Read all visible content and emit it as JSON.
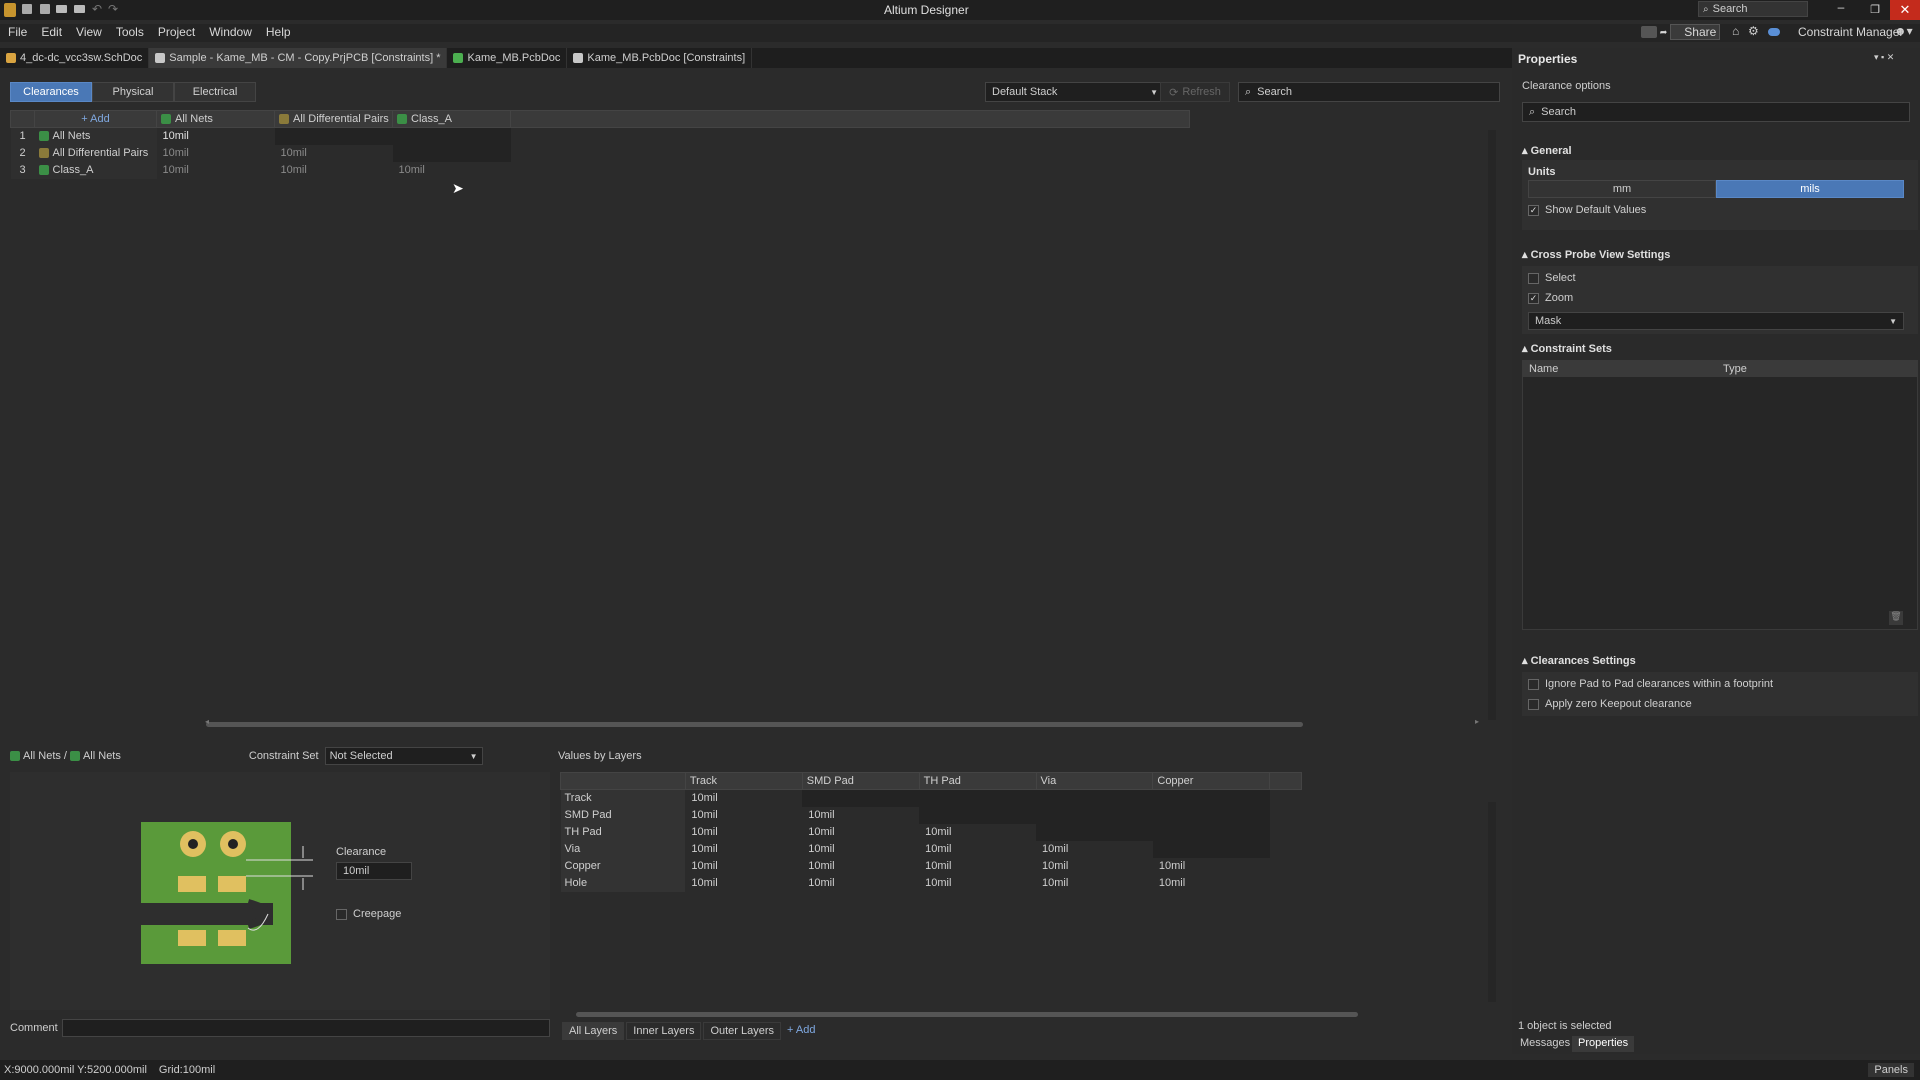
{
  "app": {
    "title": "Altium Designer",
    "search": "Search",
    "share": "Share",
    "constraint_manager": "Constraint Manager"
  },
  "menu": [
    "File",
    "Edit",
    "View",
    "Tools",
    "Project",
    "Window",
    "Help"
  ],
  "tabs": [
    {
      "label": "4_dc-dc_vcc3sw.SchDoc",
      "color": "#d9a441"
    },
    {
      "label": "Sample - Kame_MB - CM - Copy.PrjPCB [Constraints] *",
      "color": "#c8c8c8"
    },
    {
      "label": "Kame_MB.PcbDoc",
      "color": "#4caf50"
    },
    {
      "label": "Kame_MB.PcbDoc [Constraints]",
      "color": "#c8c8c8"
    }
  ],
  "toolbar": {
    "tabs": [
      "Clearances",
      "Physical",
      "Electrical"
    ],
    "stack": "Default Stack",
    "refresh": "Refresh",
    "search": "Search"
  },
  "matrix": {
    "add": "+ Add",
    "columns": [
      "All Nets",
      "All Differential Pairs",
      "Class_A"
    ],
    "rows": [
      {
        "num": "1",
        "name": "All Nets",
        "vals": [
          "10mil",
          "",
          ""
        ]
      },
      {
        "num": "2",
        "name": "All Differential Pairs",
        "vals": [
          "10mil",
          "10mil",
          ""
        ]
      },
      {
        "num": "3",
        "name": "Class_A",
        "vals": [
          "10mil",
          "10mil",
          "10mil"
        ]
      }
    ]
  },
  "detail": {
    "breadcrumb_a": "All Nets",
    "separator": "/",
    "breadcrumb_b": "All Nets",
    "constraint_set_label": "Constraint Set",
    "constraint_set_value": "Not Selected",
    "values_by_layers": "Values by Layers",
    "clearance_label": "Clearance",
    "clearance_value": "10mil",
    "creepage": "Creepage",
    "comment": "Comment"
  },
  "layers": {
    "columns": [
      "Track",
      "SMD Pad",
      "TH Pad",
      "Via",
      "Copper"
    ],
    "rows": [
      {
        "name": "Track",
        "vals": [
          "10mil",
          "",
          "",
          "",
          ""
        ]
      },
      {
        "name": "SMD Pad",
        "vals": [
          "10mil",
          "10mil",
          "",
          "",
          ""
        ]
      },
      {
        "name": "TH Pad",
        "vals": [
          "10mil",
          "10mil",
          "10mil",
          "",
          ""
        ]
      },
      {
        "name": "Via",
        "vals": [
          "10mil",
          "10mil",
          "10mil",
          "10mil",
          ""
        ]
      },
      {
        "name": "Copper",
        "vals": [
          "10mil",
          "10mil",
          "10mil",
          "10mil",
          "10mil"
        ]
      },
      {
        "name": "Hole",
        "vals": [
          "10mil",
          "10mil",
          "10mil",
          "10mil",
          "10mil"
        ]
      }
    ],
    "tabs": [
      "All Layers",
      "Inner Layers",
      "Outer Layers"
    ],
    "add": "+ Add"
  },
  "properties": {
    "title": "Properties",
    "subtitle": "Clearance options",
    "search": "Search",
    "general": "General",
    "units": "Units",
    "unit_mm": "mm",
    "unit_mils": "mils",
    "show_defaults": "Show Default Values",
    "cross_probe": "Cross Probe View Settings",
    "select": "Select",
    "zoom": "Zoom",
    "mode": "Mask",
    "constraint_sets": "Constraint Sets",
    "col_name": "Name",
    "col_type": "Type",
    "clearances_settings": "Clearances Settings",
    "ignore_pad": "Ignore Pad to Pad clearances within a footprint",
    "zero_keepout": "Apply zero Keepout clearance",
    "selected": "1 object is selected",
    "tab_messages": "Messages",
    "tab_properties": "Properties"
  },
  "status": {
    "coords": "X:9000.000mil Y:5200.000mil",
    "grid": "Grid:100mil",
    "panels": "Panels"
  }
}
